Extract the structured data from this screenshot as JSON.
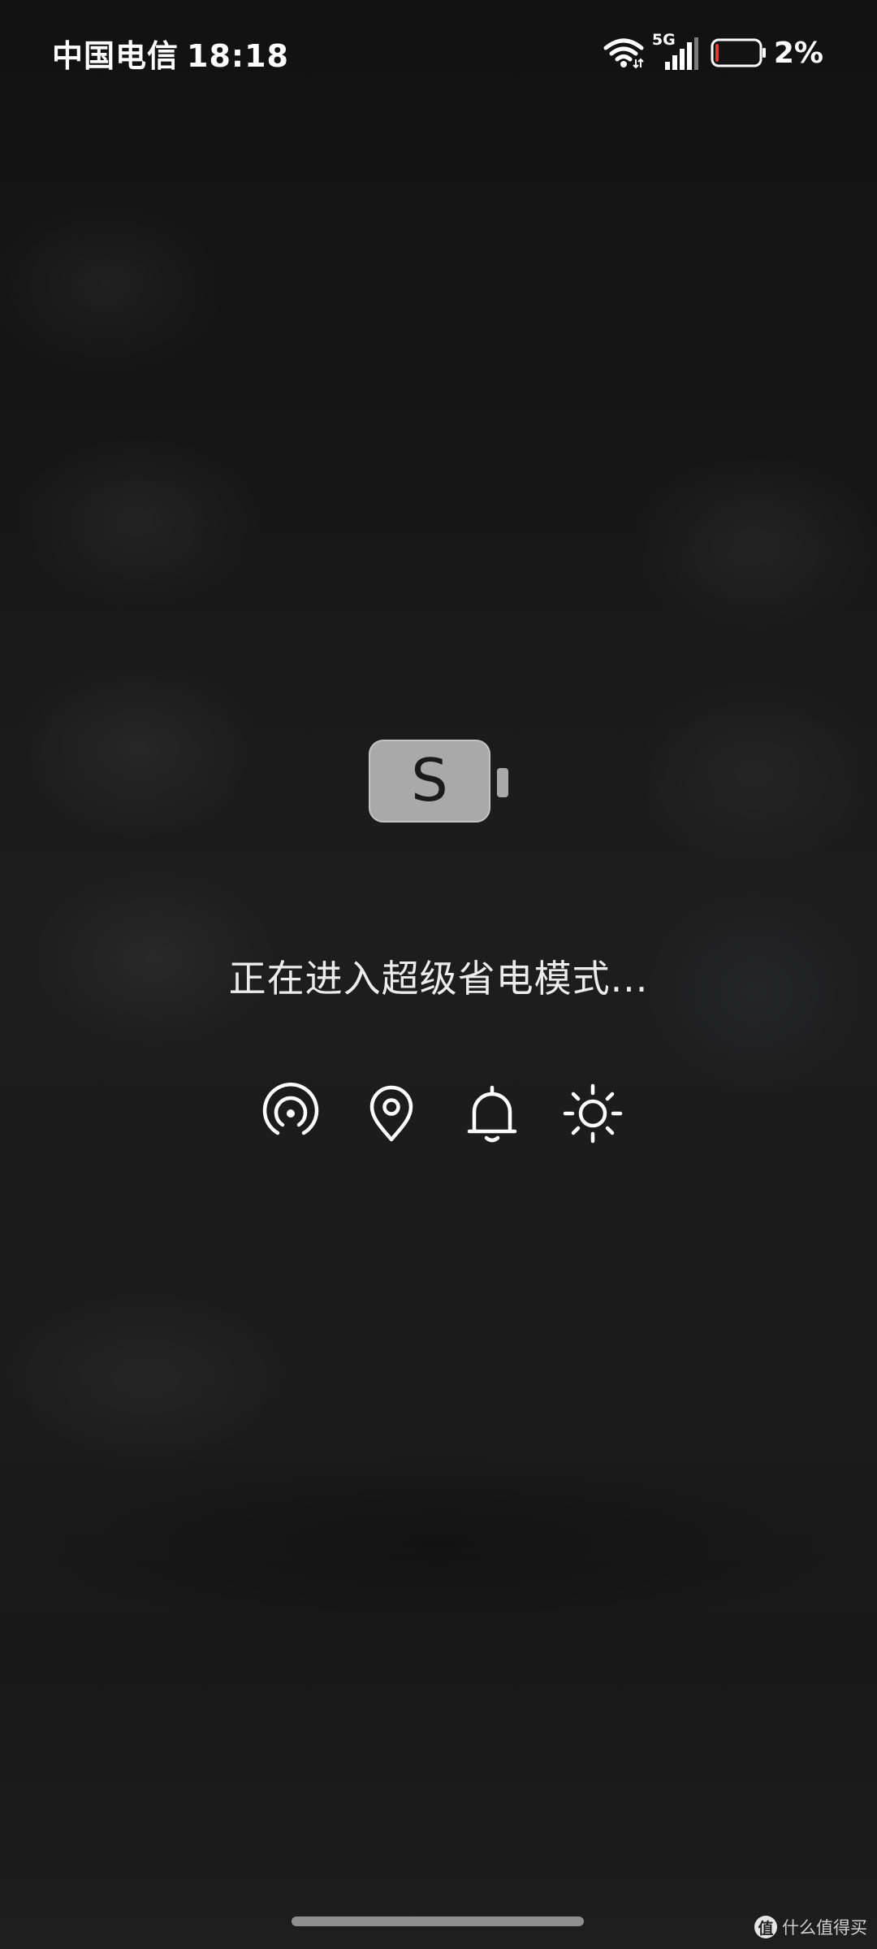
{
  "status_bar": {
    "carrier": "中国电信",
    "time": "18:18",
    "network_type": "5G",
    "battery_percent": "2%",
    "battery_level": 0.02,
    "battery_low_color": "#e53935",
    "icons": [
      "wifi-icon",
      "signal-icon",
      "battery-icon"
    ]
  },
  "super_saver": {
    "battery_letter": "S",
    "message": "正在进入超级省电模式...",
    "feature_icons": [
      "hotspot-icon",
      "location-icon",
      "bell-icon",
      "brightness-icon"
    ]
  },
  "watermark": {
    "logo_glyph": "值",
    "text": "什么值得买"
  }
}
